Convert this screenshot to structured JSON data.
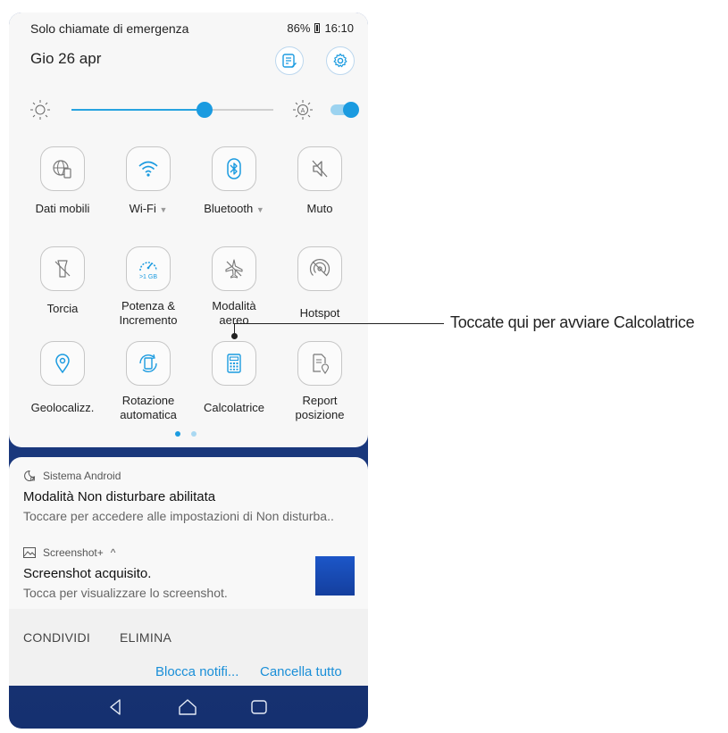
{
  "status_bar": {
    "carrier_text": "Solo chiamate di emergenza",
    "battery": "86%",
    "time": "16:10"
  },
  "header": {
    "date": "Gio 26 apr",
    "edit_icon": "edit-tiles-icon",
    "settings_icon": "gear-icon"
  },
  "brightness": {
    "level": 0.66,
    "auto": true
  },
  "tiles": [
    {
      "label": "Dati mobili",
      "icon": "globe-mobile-icon"
    },
    {
      "label": "Wi-Fi",
      "icon": "wifi-icon",
      "has_menu": true
    },
    {
      "label": "Bluetooth",
      "icon": "bluetooth-icon",
      "has_menu": true
    },
    {
      "label": "Muto",
      "icon": "mute-icon"
    },
    {
      "label": "Torcia",
      "icon": "flashlight-icon"
    },
    {
      "label": "Potenza &\nIncremento",
      "icon": "speedometer-icon",
      "badge": ">1 GB"
    },
    {
      "label": "Modalità\naereo",
      "icon": "airplane-icon"
    },
    {
      "label": "Hotspot",
      "icon": "hotspot-icon"
    },
    {
      "label": "Geolocalizz.",
      "icon": "location-icon"
    },
    {
      "label": "Rotazione\nautomatica",
      "icon": "rotation-icon"
    },
    {
      "label": "Calcolatrice",
      "icon": "calculator-icon"
    },
    {
      "label": "Report\nposizione",
      "icon": "report-location-icon"
    }
  ],
  "page_indicator": {
    "pages": 2,
    "current": 1
  },
  "notifications": [
    {
      "app": "Sistema Android",
      "app_icon": "moon-icon",
      "title": "Modalità Non disturbare abilitata",
      "text": "Toccare per accedere alle impostazioni di Non disturba.."
    },
    {
      "app": "Screenshot+",
      "app_icon": "image-icon",
      "expand": "^",
      "title": "Screenshot acquisito.",
      "text": "Tocca per visualizzare lo screenshot."
    }
  ],
  "actions": {
    "share": "CONDIVIDI",
    "delete": "ELIMINA"
  },
  "footer": {
    "block": "Blocca notifi...",
    "clear_all": "Cancella tutto"
  },
  "callout": "Toccate qui per avviare Calcolatrice",
  "colors": {
    "accent": "#1b9be0",
    "link": "#1a8fd8",
    "wallpaper": "#1d3c84"
  }
}
